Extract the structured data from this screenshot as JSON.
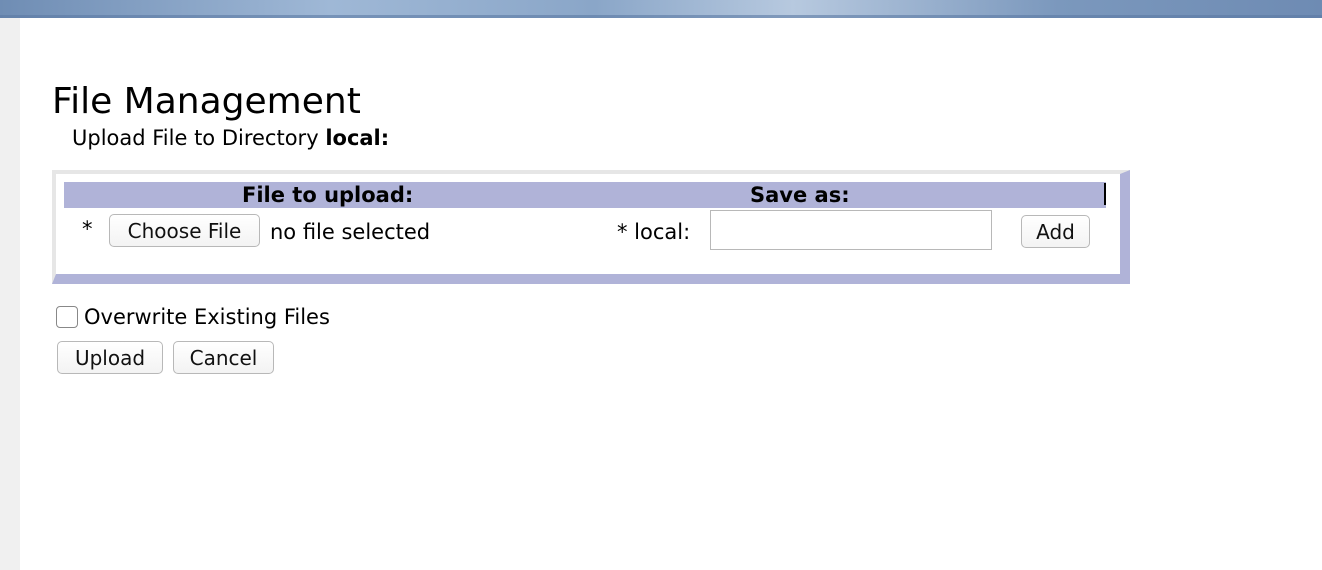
{
  "page": {
    "title": "File Management",
    "subtitle_prefix": "Upload File to Directory",
    "directory": "local:"
  },
  "upload_table": {
    "header_file": "File to upload:",
    "header_save": "Save as:",
    "required_marker": "*",
    "choose_file_label": "Choose File",
    "file_status": "no file selected",
    "save_prefix": "* local:",
    "save_value": "",
    "add_label": "Add"
  },
  "options": {
    "overwrite_label": "Overwrite Existing Files",
    "overwrite_checked": false
  },
  "actions": {
    "upload_label": "Upload",
    "cancel_label": "Cancel"
  },
  "colors": {
    "panel_accent": "#b0b3d8",
    "banner": "#7b98bd"
  }
}
